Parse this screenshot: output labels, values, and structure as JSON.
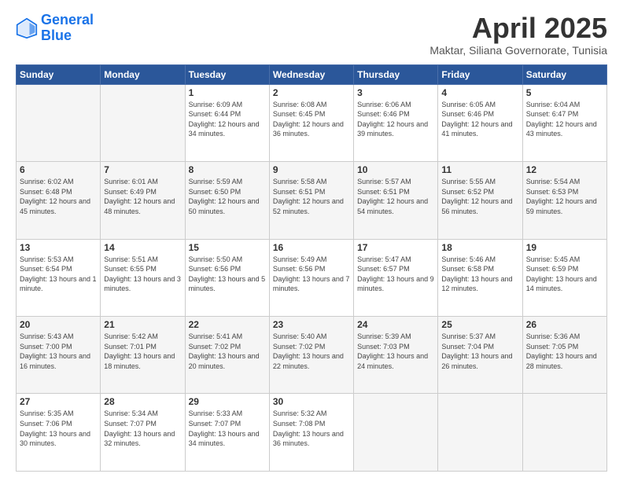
{
  "logo": {
    "line1": "General",
    "line2": "Blue"
  },
  "title": "April 2025",
  "subtitle": "Maktar, Siliana Governorate, Tunisia",
  "weekdays": [
    "Sunday",
    "Monday",
    "Tuesday",
    "Wednesday",
    "Thursday",
    "Friday",
    "Saturday"
  ],
  "weeks": [
    [
      {
        "day": null
      },
      {
        "day": null
      },
      {
        "day": "1",
        "sunrise": "Sunrise: 6:09 AM",
        "sunset": "Sunset: 6:44 PM",
        "daylight": "Daylight: 12 hours and 34 minutes."
      },
      {
        "day": "2",
        "sunrise": "Sunrise: 6:08 AM",
        "sunset": "Sunset: 6:45 PM",
        "daylight": "Daylight: 12 hours and 36 minutes."
      },
      {
        "day": "3",
        "sunrise": "Sunrise: 6:06 AM",
        "sunset": "Sunset: 6:46 PM",
        "daylight": "Daylight: 12 hours and 39 minutes."
      },
      {
        "day": "4",
        "sunrise": "Sunrise: 6:05 AM",
        "sunset": "Sunset: 6:46 PM",
        "daylight": "Daylight: 12 hours and 41 minutes."
      },
      {
        "day": "5",
        "sunrise": "Sunrise: 6:04 AM",
        "sunset": "Sunset: 6:47 PM",
        "daylight": "Daylight: 12 hours and 43 minutes."
      }
    ],
    [
      {
        "day": "6",
        "sunrise": "Sunrise: 6:02 AM",
        "sunset": "Sunset: 6:48 PM",
        "daylight": "Daylight: 12 hours and 45 minutes."
      },
      {
        "day": "7",
        "sunrise": "Sunrise: 6:01 AM",
        "sunset": "Sunset: 6:49 PM",
        "daylight": "Daylight: 12 hours and 48 minutes."
      },
      {
        "day": "8",
        "sunrise": "Sunrise: 5:59 AM",
        "sunset": "Sunset: 6:50 PM",
        "daylight": "Daylight: 12 hours and 50 minutes."
      },
      {
        "day": "9",
        "sunrise": "Sunrise: 5:58 AM",
        "sunset": "Sunset: 6:51 PM",
        "daylight": "Daylight: 12 hours and 52 minutes."
      },
      {
        "day": "10",
        "sunrise": "Sunrise: 5:57 AM",
        "sunset": "Sunset: 6:51 PM",
        "daylight": "Daylight: 12 hours and 54 minutes."
      },
      {
        "day": "11",
        "sunrise": "Sunrise: 5:55 AM",
        "sunset": "Sunset: 6:52 PM",
        "daylight": "Daylight: 12 hours and 56 minutes."
      },
      {
        "day": "12",
        "sunrise": "Sunrise: 5:54 AM",
        "sunset": "Sunset: 6:53 PM",
        "daylight": "Daylight: 12 hours and 59 minutes."
      }
    ],
    [
      {
        "day": "13",
        "sunrise": "Sunrise: 5:53 AM",
        "sunset": "Sunset: 6:54 PM",
        "daylight": "Daylight: 13 hours and 1 minute."
      },
      {
        "day": "14",
        "sunrise": "Sunrise: 5:51 AM",
        "sunset": "Sunset: 6:55 PM",
        "daylight": "Daylight: 13 hours and 3 minutes."
      },
      {
        "day": "15",
        "sunrise": "Sunrise: 5:50 AM",
        "sunset": "Sunset: 6:56 PM",
        "daylight": "Daylight: 13 hours and 5 minutes."
      },
      {
        "day": "16",
        "sunrise": "Sunrise: 5:49 AM",
        "sunset": "Sunset: 6:56 PM",
        "daylight": "Daylight: 13 hours and 7 minutes."
      },
      {
        "day": "17",
        "sunrise": "Sunrise: 5:47 AM",
        "sunset": "Sunset: 6:57 PM",
        "daylight": "Daylight: 13 hours and 9 minutes."
      },
      {
        "day": "18",
        "sunrise": "Sunrise: 5:46 AM",
        "sunset": "Sunset: 6:58 PM",
        "daylight": "Daylight: 13 hours and 12 minutes."
      },
      {
        "day": "19",
        "sunrise": "Sunrise: 5:45 AM",
        "sunset": "Sunset: 6:59 PM",
        "daylight": "Daylight: 13 hours and 14 minutes."
      }
    ],
    [
      {
        "day": "20",
        "sunrise": "Sunrise: 5:43 AM",
        "sunset": "Sunset: 7:00 PM",
        "daylight": "Daylight: 13 hours and 16 minutes."
      },
      {
        "day": "21",
        "sunrise": "Sunrise: 5:42 AM",
        "sunset": "Sunset: 7:01 PM",
        "daylight": "Daylight: 13 hours and 18 minutes."
      },
      {
        "day": "22",
        "sunrise": "Sunrise: 5:41 AM",
        "sunset": "Sunset: 7:02 PM",
        "daylight": "Daylight: 13 hours and 20 minutes."
      },
      {
        "day": "23",
        "sunrise": "Sunrise: 5:40 AM",
        "sunset": "Sunset: 7:02 PM",
        "daylight": "Daylight: 13 hours and 22 minutes."
      },
      {
        "day": "24",
        "sunrise": "Sunrise: 5:39 AM",
        "sunset": "Sunset: 7:03 PM",
        "daylight": "Daylight: 13 hours and 24 minutes."
      },
      {
        "day": "25",
        "sunrise": "Sunrise: 5:37 AM",
        "sunset": "Sunset: 7:04 PM",
        "daylight": "Daylight: 13 hours and 26 minutes."
      },
      {
        "day": "26",
        "sunrise": "Sunrise: 5:36 AM",
        "sunset": "Sunset: 7:05 PM",
        "daylight": "Daylight: 13 hours and 28 minutes."
      }
    ],
    [
      {
        "day": "27",
        "sunrise": "Sunrise: 5:35 AM",
        "sunset": "Sunset: 7:06 PM",
        "daylight": "Daylight: 13 hours and 30 minutes."
      },
      {
        "day": "28",
        "sunrise": "Sunrise: 5:34 AM",
        "sunset": "Sunset: 7:07 PM",
        "daylight": "Daylight: 13 hours and 32 minutes."
      },
      {
        "day": "29",
        "sunrise": "Sunrise: 5:33 AM",
        "sunset": "Sunset: 7:07 PM",
        "daylight": "Daylight: 13 hours and 34 minutes."
      },
      {
        "day": "30",
        "sunrise": "Sunrise: 5:32 AM",
        "sunset": "Sunset: 7:08 PM",
        "daylight": "Daylight: 13 hours and 36 minutes."
      },
      {
        "day": null
      },
      {
        "day": null
      },
      {
        "day": null
      }
    ]
  ]
}
